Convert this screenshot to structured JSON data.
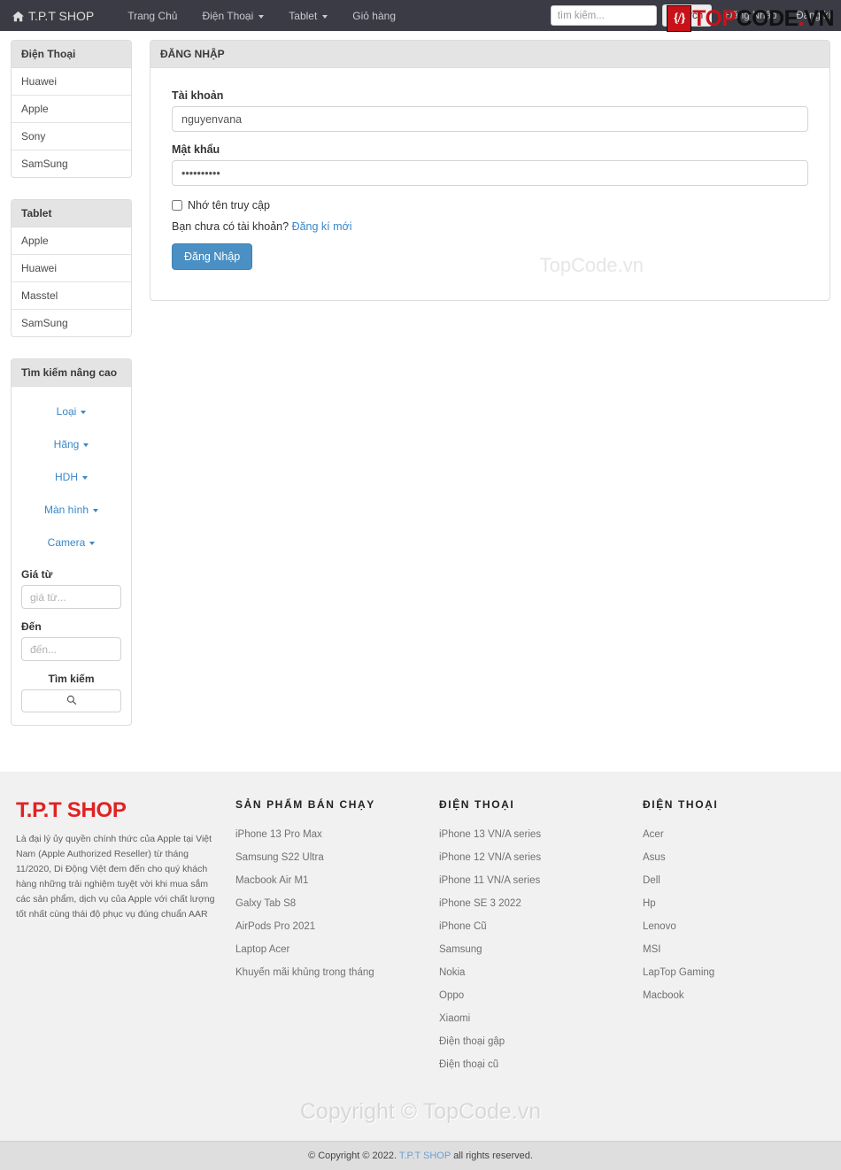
{
  "navbar": {
    "brand": "T.P.T SHOP",
    "brand_icon": "home-icon",
    "links": [
      {
        "label": "Trang Chủ",
        "caret": false
      },
      {
        "label": "Điện Thoại",
        "caret": true
      },
      {
        "label": "Tablet",
        "caret": true
      },
      {
        "label": "Giỏ hàng",
        "caret": false
      }
    ],
    "search": {
      "placeholder": "tìm kiếm...",
      "value": "",
      "button_label": "Search"
    },
    "auth": [
      {
        "label": "Đăng Nhập"
      },
      {
        "label": "Đăng kí"
      }
    ],
    "watermark": {
      "shield_glyph": "{/}",
      "top": "TOP",
      "code": "CODE",
      "dot": ".",
      "vn": "VN"
    },
    "bg_color": "#3b3b45"
  },
  "sidebar": {
    "panels": [
      {
        "title": "Điện Thoại",
        "items": [
          {
            "label": "Huawei"
          },
          {
            "label": "Apple"
          },
          {
            "label": "Sony"
          },
          {
            "label": "SamSung"
          }
        ]
      },
      {
        "title": "Tablet",
        "items": [
          {
            "label": "Apple"
          },
          {
            "label": "Huawei"
          },
          {
            "label": "Masstel"
          },
          {
            "label": "SamSung"
          }
        ]
      }
    ],
    "advanced_search": {
      "title": "Tìm kiếm nâng cao",
      "dropdowns": [
        {
          "label": "Loại"
        },
        {
          "label": "Hãng"
        },
        {
          "label": "HDH"
        },
        {
          "label": "Màn hình"
        },
        {
          "label": "Camera"
        }
      ],
      "price_from_label": "Giá từ",
      "price_from_placeholder": "giá từ...",
      "price_from_value": "",
      "price_to_label": "Đến",
      "price_to_placeholder": "đến...",
      "price_to_value": "",
      "submit_label": "Tìm kiếm",
      "submit_icon": "search-icon"
    }
  },
  "login": {
    "panel_title": "ĐĂNG NHẬP",
    "username_label": "Tài khoản",
    "username_value": "nguyenvana",
    "username_placeholder": "",
    "password_label": "Mật khẩu",
    "password_value": "••••••••••",
    "password_placeholder": "",
    "remember_label": "Nhớ tên truy cập",
    "remember_checked": false,
    "register_prompt": "Bạn chưa có tài khoản?",
    "register_link": "Đăng kí mới",
    "submit_label": "Đăng Nhập",
    "watermark": "TopCode.vn",
    "button_color": "#4a90c4"
  },
  "footer": {
    "brand": "T.P.T SHOP",
    "brand_color": "#e02222",
    "about": "Là đại lý ủy quyền chính thức của Apple tại Việt Nam (Apple Authorized Reseller) từ tháng 11/2020, Di Động Việt đem đến cho quý khách hàng những trải nghiệm tuyệt vời khi mua sắm các sản phẩm, dịch vụ của Apple với chất lượng tốt nhất cùng thái độ phục vụ đúng chuẩn AAR",
    "columns": [
      {
        "title": "SẢN PHẨM BÁN CHẠY",
        "items": [
          {
            "label": "iPhone 13 Pro Max"
          },
          {
            "label": "Samsung S22 Ultra"
          },
          {
            "label": "Macbook Air M1"
          },
          {
            "label": "Galxy Tab S8"
          },
          {
            "label": "AirPods Pro 2021"
          },
          {
            "label": "Laptop Acer"
          },
          {
            "label": "Khuyến mãi khủng trong tháng"
          }
        ]
      },
      {
        "title": "ĐIỆN THOẠI",
        "items": [
          {
            "label": "iPhone 13 VN/A series"
          },
          {
            "label": "iPhone 12 VN/A series"
          },
          {
            "label": "iPhone 11 VN/A series"
          },
          {
            "label": "iPhone SE 3 2022"
          },
          {
            "label": "iPhone Cũ"
          },
          {
            "label": "Samsung"
          },
          {
            "label": "Nokia"
          },
          {
            "label": "Oppo"
          },
          {
            "label": "Xiaomi"
          },
          {
            "label": "Điện thoại gập"
          },
          {
            "label": "Điện thoại cũ"
          }
        ]
      },
      {
        "title": "ĐIỆN THOẠI",
        "items": [
          {
            "label": "Acer"
          },
          {
            "label": "Asus"
          },
          {
            "label": "Dell"
          },
          {
            "label": "Hp"
          },
          {
            "label": "Lenovo"
          },
          {
            "label": "MSI"
          },
          {
            "label": "LapTop Gaming"
          },
          {
            "label": "Macbook"
          }
        ]
      }
    ],
    "watermark": "Copyright © TopCode.vn",
    "copyright_prefix": "© Copyright © 2022.",
    "copyright_link": "T.P.T SHOP",
    "copyright_suffix": "all rights reserved."
  }
}
